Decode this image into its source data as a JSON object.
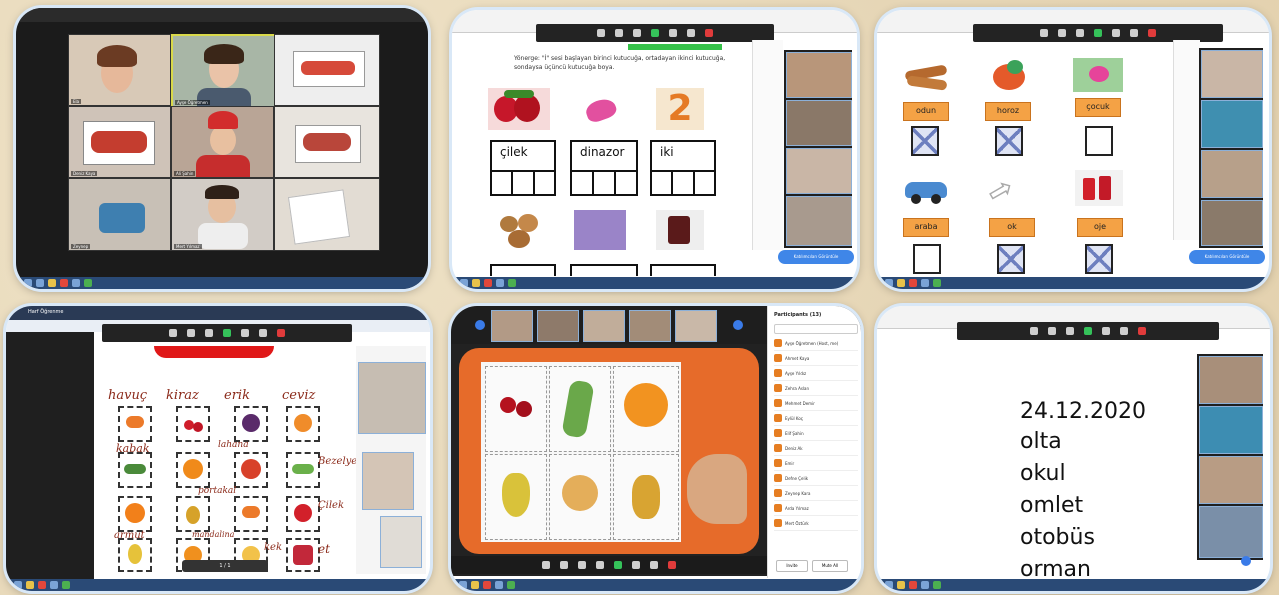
{
  "panel1": {
    "tile_labels": [
      "Ela",
      "Ayşe Öğretmen",
      "",
      "Deniz Kaya",
      "Ali Şahin",
      "",
      "Zeynep",
      "Mert Yılmaz",
      ""
    ]
  },
  "panel2": {
    "instruction": "Yönerge: \"İ\" sesi başlayan birinci kutucuğa, ortadayan ikinci kutucuğa, sondaysa üçüncü kutucuğa boya.",
    "words": [
      "çilek",
      "dinazor",
      "iki"
    ],
    "side_button": "Katılımcıları Görüntüle"
  },
  "panel3": {
    "labels": [
      "odun",
      "horoz",
      "çocuk",
      "araba",
      "ok",
      "oje"
    ],
    "checked": [
      true,
      true,
      false,
      false,
      true,
      true
    ],
    "side_button": "Katılımcıları Görüntüle"
  },
  "panel4": {
    "tab_title": "Harf Öğrenme",
    "header_words": [
      "havuç",
      "kiraz",
      "erik",
      "ceviz"
    ],
    "side_words": [
      "Bezelye",
      "Çilek",
      "et"
    ],
    "mid_words": [
      "kabak",
      "lahana",
      "portakal",
      "armut",
      "havuç",
      "kek",
      "mandalina"
    ],
    "page_indicator": "1 / 1"
  },
  "panel5": {
    "participants_title": "Participants (13)",
    "participants": [
      "Ayşe Öğretmen (Host, me)",
      "Ahmet Kaya",
      "Ayşe Yıldız",
      "Zehra Aslan",
      "Mehmet Demir",
      "Eylül Koç",
      "Elif Şahin",
      "Deniz Ak",
      "Emir",
      "Defne Çelik",
      "Zeynep Kara",
      "Arda Yılmaz",
      "Mert Öztürk"
    ],
    "buttons": [
      "Invite",
      "Mute All"
    ]
  },
  "panel6": {
    "date": "24.12.2020",
    "words": [
      "olta",
      "okul",
      "omlet",
      "otobüs",
      "orman"
    ]
  }
}
